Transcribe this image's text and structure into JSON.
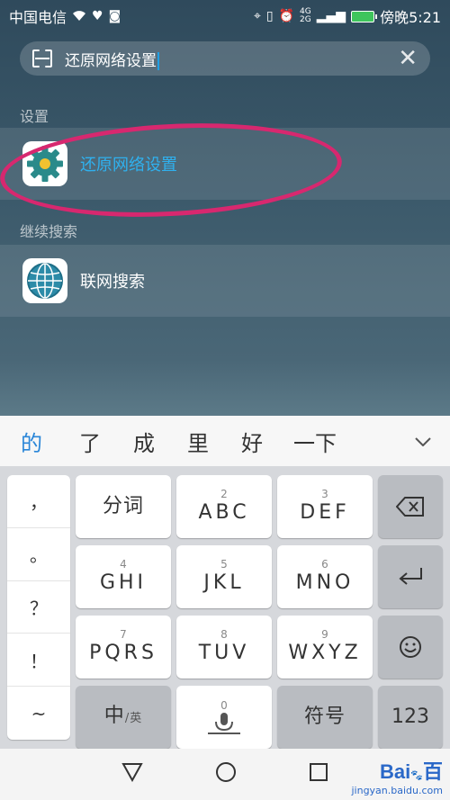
{
  "status_bar": {
    "carrier": "中国电信",
    "network_labels": [
      "4G",
      "2G"
    ],
    "time": "傍晚5:21",
    "battery_color": "#3ec55c"
  },
  "search": {
    "query": "还原网络设置"
  },
  "sections": {
    "settings_label": "设置",
    "continue_label": "继续搜索"
  },
  "results": {
    "settings_item": "还原网络设置",
    "web_item": "联网搜索"
  },
  "candidates": [
    "的",
    "了",
    "成",
    "里",
    "好",
    "一下"
  ],
  "keyboard": {
    "symbols": [
      "，",
      "。",
      "？",
      "！",
      "~"
    ],
    "keys": {
      "k1": {
        "num": "",
        "main": "分词"
      },
      "k2": {
        "num": "2",
        "main": "ABC"
      },
      "k3": {
        "num": "3",
        "main": "DEF"
      },
      "k4": {
        "num": "4",
        "main": "GHI"
      },
      "k5": {
        "num": "5",
        "main": "JKL"
      },
      "k6": {
        "num": "6",
        "main": "MNO"
      },
      "k7": {
        "num": "7",
        "main": "PQRS"
      },
      "k8": {
        "num": "8",
        "main": "TUV"
      },
      "k9": {
        "num": "9",
        "main": "WXYZ"
      },
      "k0": {
        "num": "0"
      }
    },
    "lang_key": {
      "main": "中",
      "sub": "/英"
    },
    "symbol_key": "符号",
    "num_key": "123"
  },
  "watermark": {
    "brand": "Bai",
    "brand2": "百",
    "url": "jingyan.baidu.com"
  },
  "colors": {
    "highlight": "#2fb1ef",
    "annotation": "#d7286f",
    "candidate_accent": "#2a86d8"
  }
}
